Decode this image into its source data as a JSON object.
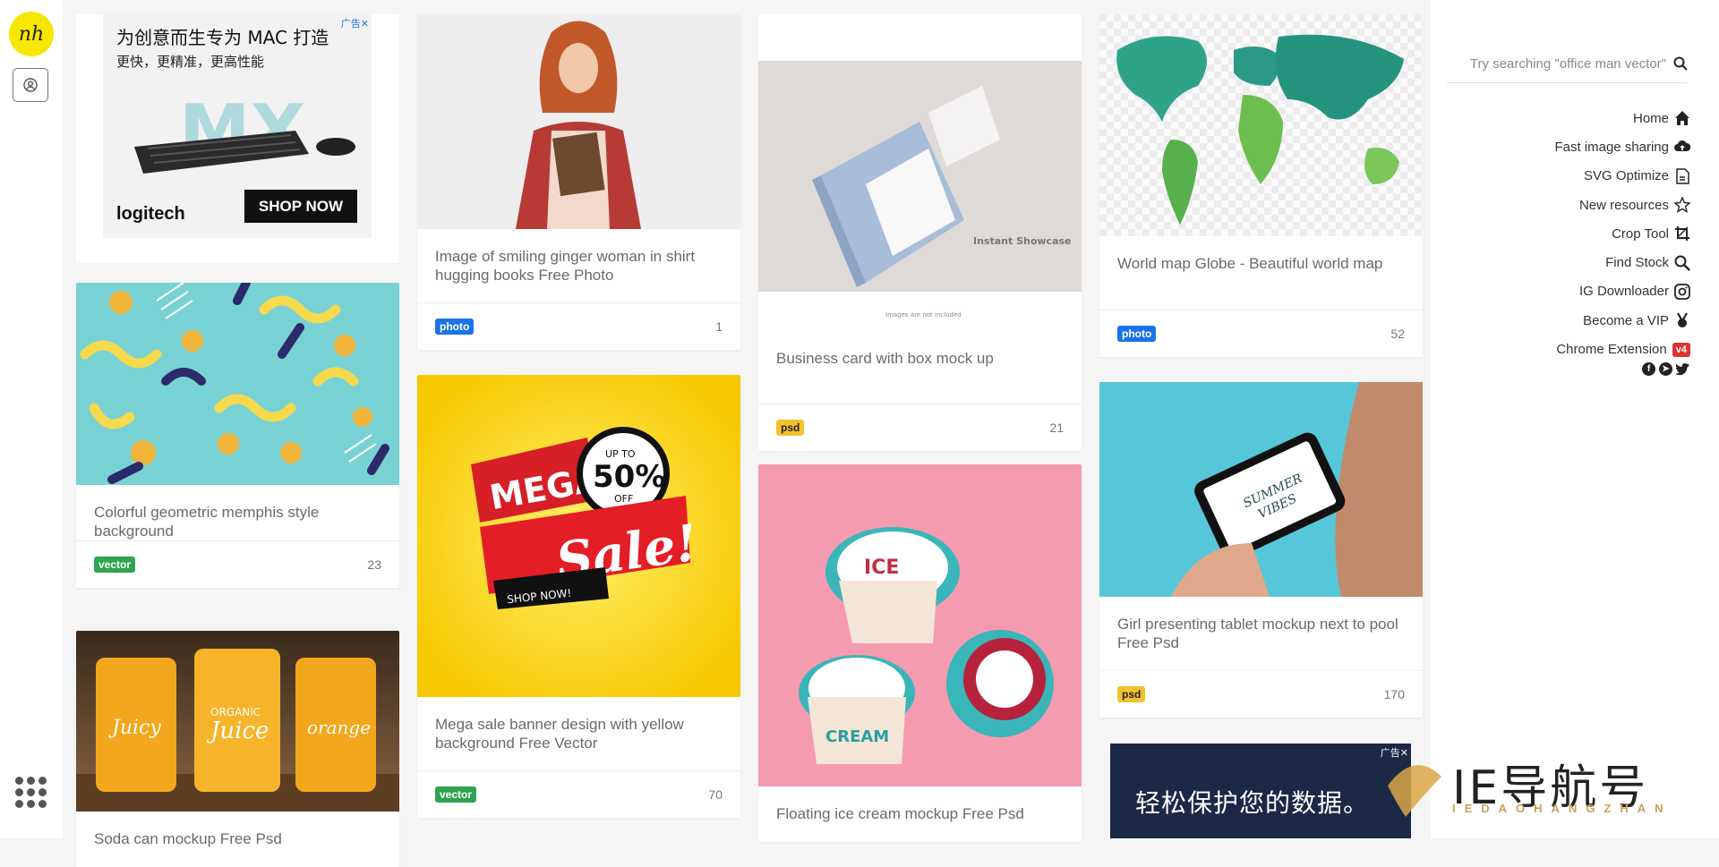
{
  "ads": {
    "top": {
      "line1": "为创意而生专为 MAC 打造",
      "line2": "更快，更精准，更高性能",
      "brand": "logitech",
      "cta": "SHOP NOW",
      "product_mark": "MX",
      "close_marker": "广告✕"
    },
    "bottom": {
      "text": "轻松保护您的数据。",
      "close_marker": "广告✕"
    }
  },
  "search": {
    "placeholder": "Try searching \"office man vector\""
  },
  "nav": [
    {
      "label": "Home",
      "icon": "home-icon"
    },
    {
      "label": "Fast image sharing",
      "icon": "cloud-upload-icon"
    },
    {
      "label": "SVG Optimize",
      "icon": "svg-file-icon"
    },
    {
      "label": "New resources",
      "icon": "star-icon"
    },
    {
      "label": "Crop Tool",
      "icon": "crop-icon"
    },
    {
      "label": "Find Stock",
      "icon": "search-image-icon"
    },
    {
      "label": "IG Downloader",
      "icon": "instagram-icon"
    },
    {
      "label": "Become a VIP",
      "icon": "medal-icon"
    },
    {
      "label": "Chrome Extension",
      "icon": "chrome-extension-icon",
      "tag": "v4"
    }
  ],
  "cards": [
    {
      "title": "Colorful geometric memphis style background",
      "badge": "vector",
      "count": "23"
    },
    {
      "title": "Soda can mockup Free Psd"
    },
    {
      "title": "Image of smiling ginger woman in shirt hugging books Free Photo",
      "badge": "photo",
      "count": "1"
    },
    {
      "title": "Mega sale banner design with yellow background Free Vector",
      "badge": "vector",
      "count": "70"
    },
    {
      "title": "Business card with box mock up",
      "badge": "psd",
      "count": "21"
    },
    {
      "title": "Floating ice cream mockup Free Psd"
    },
    {
      "title": "World map Globe - Beautiful world map",
      "badge": "photo",
      "count": "52"
    },
    {
      "title": "Girl presenting tablet mockup next to pool Free Psd",
      "badge": "psd",
      "count": "170"
    }
  ],
  "image_text": {
    "mega": "MEGA",
    "up_to": "UP TO",
    "fifty": "50%",
    "off": "OFF",
    "sale": "Sale!",
    "shop_now": "SHOP NOW!",
    "instant": "Instant Showcase",
    "images_not_included": "Images are not included",
    "juicy": "Juicy",
    "organic": "ORGANIC",
    "juice": "Juice",
    "orange": "orange",
    "ice": "ICE",
    "cream": "CREAM",
    "summer": "SUMMER",
    "vibes": "VIBES"
  },
  "watermark": {
    "big": "IE导航号",
    "small": "IEDAOHANGZHAN"
  },
  "logo_text": "nh"
}
